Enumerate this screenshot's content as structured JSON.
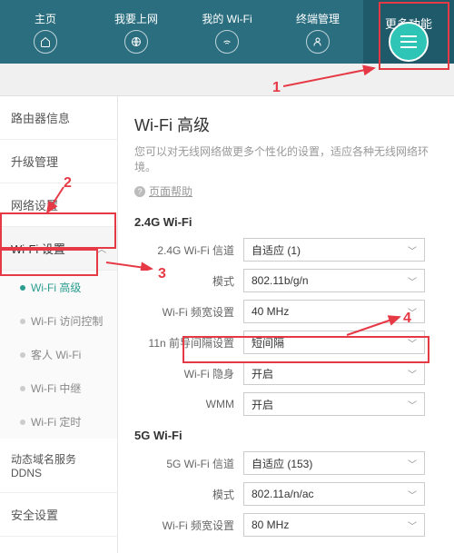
{
  "nav": {
    "home": "主页",
    "internet": "我要上网",
    "wifi": "我的 Wi-Fi",
    "devices": "终端管理",
    "more": "更多功能"
  },
  "sidebar": {
    "router_info": "路由器信息",
    "upgrade": "升级管理",
    "network": "网络设置",
    "wifi_settings": "Wi-Fi 设置",
    "sub": {
      "advanced": "Wi-Fi 高级",
      "access": "Wi-Fi 访问控制",
      "guest": "客人 Wi-Fi",
      "repeater": "Wi-Fi 中继",
      "timer": "Wi-Fi 定时"
    },
    "ddns": "动态域名服务\nDDNS",
    "security": "安全设置"
  },
  "main": {
    "title": "Wi-Fi 高级",
    "desc": "您可以对无线网络做更多个性化的设置，适应各种无线网络环境。",
    "help": "页面帮助",
    "section_24g": "2.4G Wi-Fi",
    "section_5g": "5G Wi-Fi",
    "labels": {
      "channel24": "2.4G Wi-Fi 信道",
      "mode": "模式",
      "bandwidth": "Wi-Fi 频宽设置",
      "preamble": "11n 前导间隔设置",
      "hidden": "Wi-Fi 隐身",
      "wmm": "WMM",
      "channel5": "5G Wi-Fi 信道"
    },
    "values": {
      "channel24": "自适应 (1)",
      "mode24": "802.11b/g/n",
      "bandwidth24": "40 MHz",
      "preamble": "短间隔",
      "hidden": "开启",
      "wmm": "开启",
      "channel5": "自适应 (153)",
      "mode5": "802.11a/n/ac",
      "bandwidth5": "80 MHz"
    }
  },
  "annotations": {
    "n1": "1",
    "n2": "2",
    "n3": "3",
    "n4": "4"
  }
}
